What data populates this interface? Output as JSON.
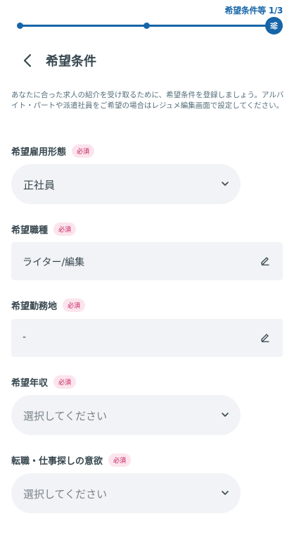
{
  "progress": {
    "label": "希望条件等 1/3",
    "current": 1,
    "total": 3
  },
  "header": {
    "title": "希望条件"
  },
  "description": "あなたに合った求人の紹介を受け取るために、希望条件を登録しましょう。アルバイト・パートや派遣社員をご希望の場合はレジュメ編集画面で設定してください。",
  "required_badge": "必須",
  "fields": {
    "employment_type": {
      "label": "希望雇用形態",
      "value": "正社員"
    },
    "job_type": {
      "label": "希望職種",
      "value": "ライター/編集"
    },
    "location": {
      "label": "希望勤務地",
      "value": "-"
    },
    "salary": {
      "label": "希望年収",
      "placeholder": "選択してください"
    },
    "intent": {
      "label": "転職・仕事探しの意欲",
      "placeholder": "選択してください"
    }
  },
  "colors": {
    "accent": "#1565a8",
    "badge_bg": "#fce4ec",
    "badge_text": "#c2185b",
    "field_bg": "#f2f3f6"
  },
  "icons": {
    "back": "chevron-left-icon",
    "current_step": "sliders-icon",
    "dropdown": "chevron-down-icon",
    "edit": "pencil-icon"
  }
}
